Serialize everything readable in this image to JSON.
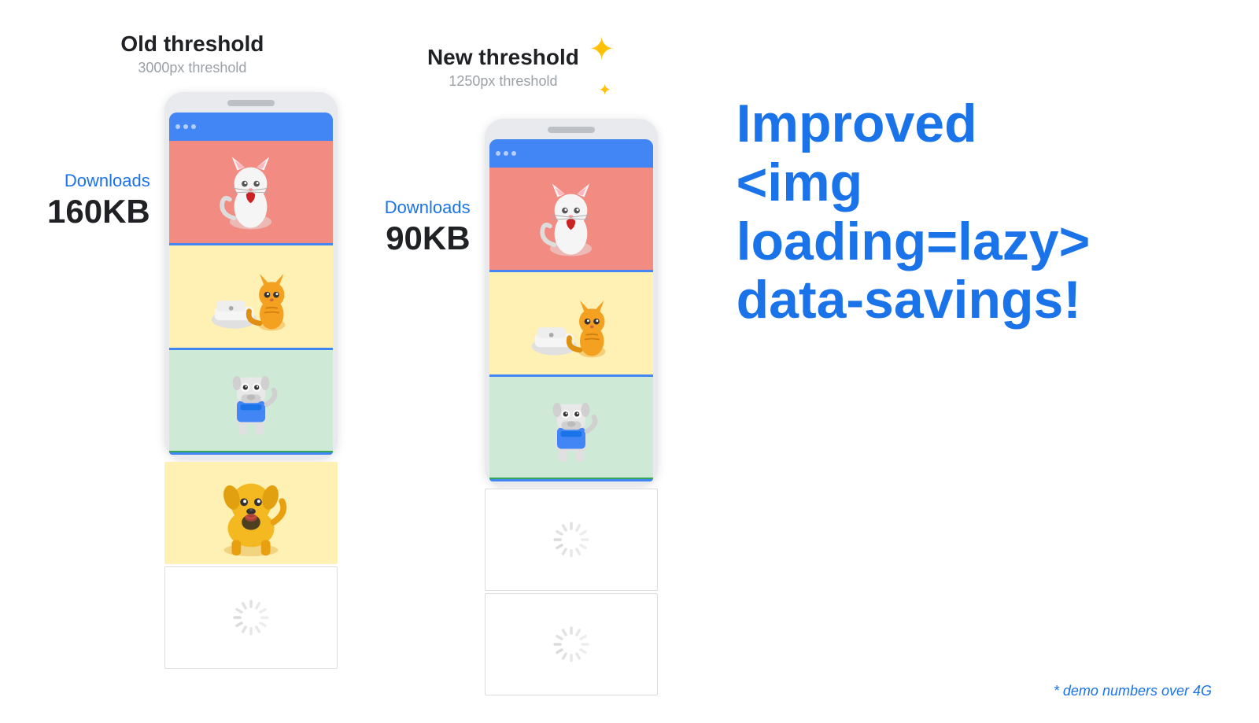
{
  "old_threshold": {
    "title": "Old threshold",
    "subtitle": "3000px threshold",
    "downloads_label": "Downloads",
    "downloads_size": "160KB"
  },
  "new_threshold": {
    "title": "New threshold",
    "subtitle": "1250px threshold",
    "downloads_label": "Downloads",
    "downloads_size": "90KB"
  },
  "right_section": {
    "line1": "Improved",
    "line2": "<img loading=lazy>",
    "line3": "data-savings!"
  },
  "demo_note": "* demo numbers over 4G",
  "sparkle_icon": "✦",
  "colors": {
    "blue": "#1a73e8",
    "dark": "#202124",
    "gray": "#9aa0a6",
    "yellow_star": "#FFC107"
  }
}
